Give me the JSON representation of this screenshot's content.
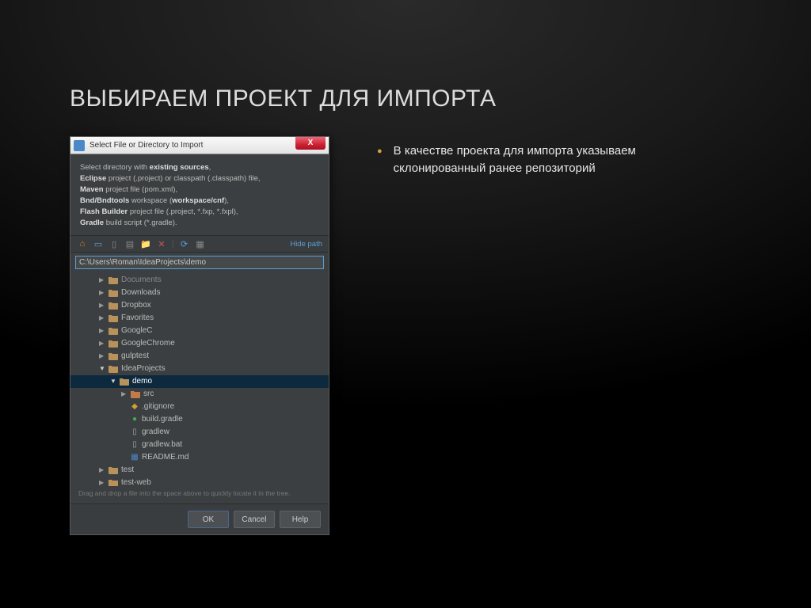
{
  "slide": {
    "title": "ВЫБИРАЕМ ПРОЕКТ ДЛЯ ИМПОРТА",
    "bullet_text": "В качестве проекта для импорта указываем склонированный ранее репозиторий"
  },
  "dialog": {
    "window_title": "Select File or Directory to Import",
    "close_label": "X",
    "description": {
      "line1_pre": "Select directory with ",
      "line1_b": "existing sources",
      "line1_post": ",",
      "line2_b": "Eclipse",
      "line2_post": " project (.project) or classpath (.classpath) file,",
      "line3_b": "Maven",
      "line3_post": " project file (pom.xml),",
      "line4_b": "Bnd/Bndtools",
      "line4_post": " workspace (",
      "line4_b2": "workspace/cnf",
      "line4_post2": "),",
      "line5_b": "Flash Builder",
      "line5_post": " project file (.project, *.fxp, *.fxpl),",
      "line6_b": "Gradle",
      "line6_post": " build script (*.gradle)."
    },
    "hide_path": "Hide path",
    "path_value": "C:\\Users\\Roman\\IdeaProjects\\demo",
    "tree": [
      {
        "indent": 2,
        "arrow": "right",
        "icon": "folder",
        "label": "Documents",
        "faded": true
      },
      {
        "indent": 2,
        "arrow": "right",
        "icon": "folder",
        "label": "Downloads"
      },
      {
        "indent": 2,
        "arrow": "right",
        "icon": "folder",
        "label": "Dropbox"
      },
      {
        "indent": 2,
        "arrow": "right",
        "icon": "folder",
        "label": "Favorites"
      },
      {
        "indent": 2,
        "arrow": "right",
        "icon": "folder",
        "label": "GoogleC"
      },
      {
        "indent": 2,
        "arrow": "right",
        "icon": "folder",
        "label": "GoogleChrome"
      },
      {
        "indent": 2,
        "arrow": "right",
        "icon": "folder",
        "label": "gulptest"
      },
      {
        "indent": 2,
        "arrow": "down",
        "icon": "folder",
        "label": "IdeaProjects"
      },
      {
        "indent": 3,
        "arrow": "down",
        "icon": "folder",
        "label": "demo",
        "selected": true
      },
      {
        "indent": 4,
        "arrow": "right",
        "icon": "folder-src",
        "label": "src"
      },
      {
        "indent": 4,
        "arrow": "",
        "icon": "gitignore",
        "label": ".gitignore"
      },
      {
        "indent": 4,
        "arrow": "",
        "icon": "gradle",
        "label": "build.gradle"
      },
      {
        "indent": 4,
        "arrow": "",
        "icon": "file",
        "label": "gradlew"
      },
      {
        "indent": 4,
        "arrow": "",
        "icon": "file",
        "label": "gradlew.bat"
      },
      {
        "indent": 4,
        "arrow": "",
        "icon": "readme",
        "label": "README.md"
      },
      {
        "indent": 2,
        "arrow": "right",
        "icon": "folder",
        "label": "test"
      },
      {
        "indent": 2,
        "arrow": "right",
        "icon": "folder",
        "label": "test-web"
      }
    ],
    "hint": "Drag and drop a file into the space above to quickly locate it in the tree.",
    "buttons": {
      "ok": "OK",
      "cancel": "Cancel",
      "help": "Help"
    }
  }
}
